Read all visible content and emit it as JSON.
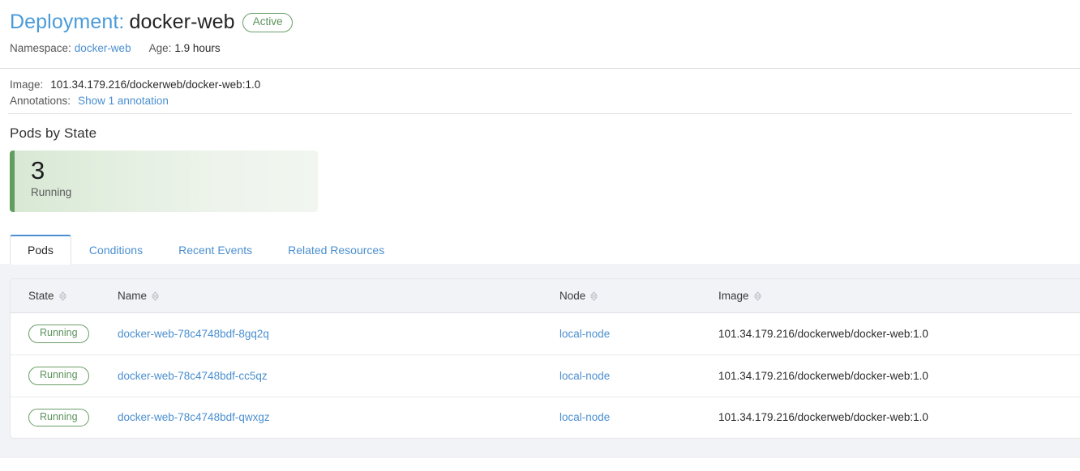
{
  "header": {
    "kind_label": "Deployment:",
    "resource_name": "docker-web",
    "state_badge": "Active",
    "namespace_label": "Namespace:",
    "namespace_value": "docker-web",
    "age_label": "Age:",
    "age_value": "1.9 hours"
  },
  "info": {
    "image_label": "Image:",
    "image_value": "101.34.179.216/dockerweb/docker-web:1.0",
    "annotations_label": "Annotations:",
    "annotations_link": "Show 1 annotation"
  },
  "pods_by_state": {
    "section_title": "Pods by State",
    "cards": [
      {
        "count": "3",
        "label": "Running",
        "accent_color": "#5f9e5f"
      }
    ]
  },
  "tabs": [
    {
      "label": "Pods",
      "active": true
    },
    {
      "label": "Conditions",
      "active": false
    },
    {
      "label": "Recent Events",
      "active": false
    },
    {
      "label": "Related Resources",
      "active": false
    }
  ],
  "table": {
    "columns": [
      {
        "label": "State",
        "sortable": true
      },
      {
        "label": "Name",
        "sortable": true
      },
      {
        "label": "Node",
        "sortable": true
      },
      {
        "label": "Image",
        "sortable": true
      }
    ],
    "rows": [
      {
        "state": "Running",
        "name": "docker-web-78c4748bdf-8gq2q",
        "node": "local-node",
        "image": "101.34.179.216/dockerweb/docker-web:1.0"
      },
      {
        "state": "Running",
        "name": "docker-web-78c4748bdf-cc5qz",
        "node": "local-node",
        "image": "101.34.179.216/dockerweb/docker-web:1.0"
      },
      {
        "state": "Running",
        "name": "docker-web-78c4748bdf-qwxgz",
        "node": "local-node",
        "image": "101.34.179.216/dockerweb/docker-web:1.0"
      }
    ]
  },
  "colors": {
    "link": "#4b8fd0",
    "title_kind": "#4b9bd8",
    "success_green": "#5c925c",
    "panel_bg": "#f2f3f7"
  }
}
